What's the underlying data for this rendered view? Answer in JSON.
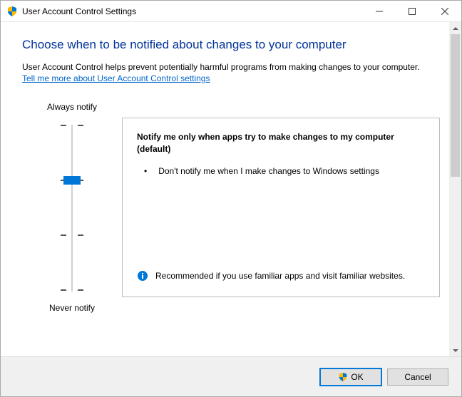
{
  "window": {
    "title": "User Account Control Settings"
  },
  "page": {
    "heading": "Choose when to be notified about changes to your computer",
    "description": "User Account Control helps prevent potentially harmful programs from making changes to your computer.",
    "link": "Tell me more about User Account Control settings"
  },
  "slider": {
    "top_label": "Always notify",
    "bottom_label": "Never notify",
    "level": 1,
    "levels": 4
  },
  "infobox": {
    "title": "Notify me only when apps try to make changes to my computer (default)",
    "bullets": [
      "Don't notify me when I make changes to Windows settings"
    ],
    "recommend": "Recommended if you use familiar apps and visit familiar websites."
  },
  "buttons": {
    "ok": "OK",
    "cancel": "Cancel"
  }
}
